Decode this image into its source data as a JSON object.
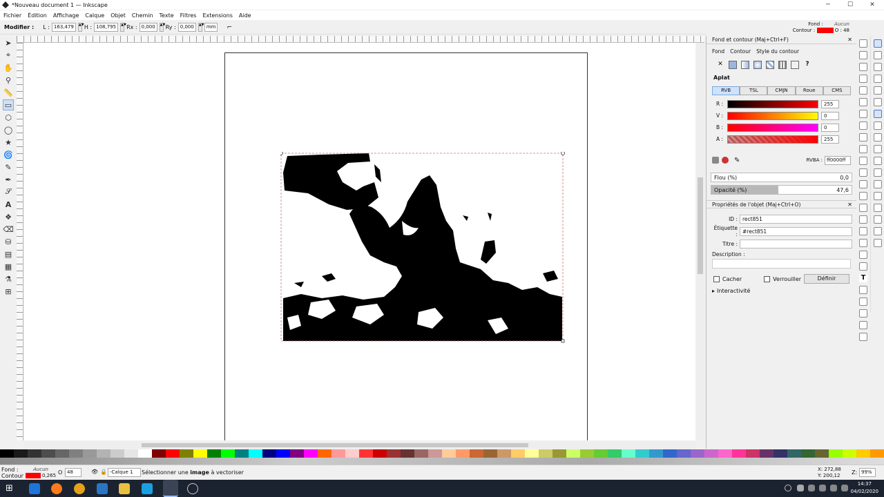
{
  "window": {
    "title": "*Nouveau document 1 — Inkscape",
    "minimize": "─",
    "maximize": "☐",
    "close": "✕"
  },
  "menu": [
    "Fichier",
    "Édition",
    "Affichage",
    "Calque",
    "Objet",
    "Chemin",
    "Texte",
    "Filtres",
    "Extensions",
    "Aide"
  ],
  "top_style": {
    "fond_label": "Fond :",
    "contour_label": "Contour :",
    "fond_value": "Aucun",
    "opacity_label": "O :",
    "opacity": "48",
    "fill_color": "#ff0000"
  },
  "toolcontrols": {
    "mode": "Modifier :",
    "l_label": "L :",
    "l_value": "163,479",
    "h_label": "H :",
    "h_value": "108,795",
    "rx_label": "Rx :",
    "rx_value": "0,000",
    "ry_label": "Ry :",
    "ry_value": "0,000",
    "unit": "mm"
  },
  "fillstroke": {
    "title": "Fond et contour (Maj+Ctrl+F)",
    "tabs": [
      "Fond",
      "Contour",
      "Style du contour"
    ],
    "flat_label": "Aplat",
    "modes": [
      "RVB",
      "TSL",
      "CMJN",
      "Roue",
      "CMS"
    ],
    "channels": [
      {
        "label": "R :",
        "value": "255"
      },
      {
        "label": "V :",
        "value": "0"
      },
      {
        "label": "B :",
        "value": "0"
      },
      {
        "label": "A :",
        "value": "255"
      }
    ],
    "rgba_label": "RVBA :",
    "rgba_value": "ff0000ff",
    "blur_label": "Flou (%)",
    "blur_value": "0,0",
    "opacity_label": "Opacité (%)",
    "opacity_value": "47,6",
    "opacity_fraction": 0.476
  },
  "objprops": {
    "title": "Propriétés de l'objet (Maj+Ctrl+O)",
    "id_label": "ID :",
    "id_value": "rect851",
    "label_label": "Étiquette :",
    "label_value": "#rect851",
    "title_label": "Titre :",
    "title_value": "",
    "desc_label": "Description :",
    "hide_label": "Cacher",
    "lock_label": "Verrouiller",
    "set_button": "Définir",
    "interactivity": "Interactivité"
  },
  "status": {
    "fond_label": "Fond :",
    "fond_value": "Aucun",
    "contour_label": "Contour :",
    "stroke_width": "0,265",
    "opacity_label": "O :",
    "opacity": "48",
    "layer": "-Calque 1",
    "message_pre": "Sélectionner une ",
    "message_bold": "image",
    "message_post": " à vectoriser",
    "coords_x": "X: 272,88",
    "coords_y": "Y: 200,12",
    "zoom_label": "Z:",
    "zoom": "99%"
  },
  "clock": {
    "time": "14:37",
    "date": "04/02/2020"
  },
  "palette": [
    "#000000",
    "#1a1a1a",
    "#333333",
    "#4d4d4d",
    "#666666",
    "#808080",
    "#999999",
    "#b3b3b3",
    "#cccccc",
    "#e6e6e6",
    "#ffffff",
    "#800000",
    "#ff0000",
    "#808000",
    "#ffff00",
    "#008000",
    "#00ff00",
    "#008080",
    "#00ffff",
    "#000080",
    "#0000ff",
    "#800080",
    "#ff00ff",
    "#ff6600",
    "#ff9999",
    "#ffcccc",
    "#ff3333",
    "#cc0000",
    "#993333",
    "#663333",
    "#996666",
    "#cc9999",
    "#ffcc99",
    "#ff9966",
    "#cc6633",
    "#996633",
    "#cc9966",
    "#ffcc66",
    "#ffff99",
    "#cccc66",
    "#999933",
    "#ccff66",
    "#99cc33",
    "#66cc33",
    "#33cc66",
    "#66ffcc",
    "#33cccc",
    "#3399cc",
    "#3366cc",
    "#6666cc",
    "#9966cc",
    "#cc66cc",
    "#ff66cc",
    "#ff3399",
    "#cc3366",
    "#663366",
    "#333366",
    "#336666",
    "#336633",
    "#666633",
    "#99ff00",
    "#ccff00",
    "#ffcc00",
    "#ff9900"
  ]
}
